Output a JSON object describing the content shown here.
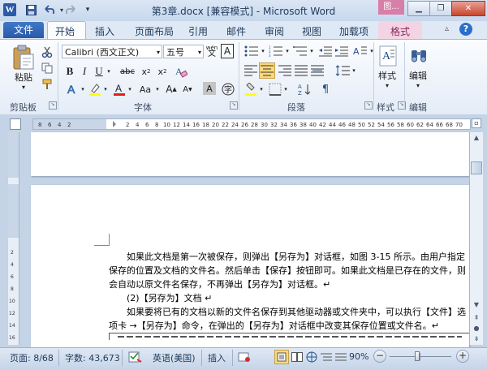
{
  "window": {
    "title": "第3章.docx [兼容模式] - Microsoft Word",
    "context_tab_header": "图..."
  },
  "qat": {
    "app_icon": "W",
    "save_icon": "save-icon",
    "undo_icon": "undo-icon",
    "redo_icon": "redo-icon"
  },
  "tabs": {
    "file": "文件",
    "items": [
      "开始",
      "插入",
      "页面布局",
      "引用",
      "邮件",
      "审阅",
      "视图",
      "加载项"
    ],
    "format": "格式"
  },
  "ribbon": {
    "clipboard": {
      "paste": "粘贴",
      "label": "剪贴板"
    },
    "font": {
      "name": "Calibri (西文正文)",
      "size": "五号",
      "label": "字体",
      "wen": "wén",
      "A_box": "A"
    },
    "paragraph": {
      "label": "段落"
    },
    "styles": {
      "label": "样式"
    },
    "editing": {
      "label": "编辑"
    }
  },
  "document": {
    "lines": [
      "如果此文档是第一次被保存，则弹出【另存为】对话框，如图 3-15 所示。由用户指定",
      "保存的位置及文档的文件名。然后单击【保存】按钮即可。如果此文档是已存在的文件，则",
      "会自动以原文件名保存，不再弹出【另存为】对话框。↵",
      "(2)【另存为】文档 ↵",
      "如果要将已有的文档以新的文件名保存到其他驱动器或文件夹中，可以执行【文件】选",
      "项卡 →【另存为】命令，在弹出的【另存为】对话框中改变其保存位置或文件名。↵"
    ]
  },
  "status": {
    "page": "页面: 8/68",
    "words": "字数: 43,673",
    "language": "英语(美国)",
    "mode": "插入",
    "zoom": "90%",
    "zoom_level": 0.9
  },
  "colors": {
    "file_tab": "#2a5aa8",
    "format_tab": "#d77fa8",
    "ribbon_bg": "#e4ecf7",
    "highlight_yellow": "#ffff00",
    "font_color_red": "#e02020"
  }
}
